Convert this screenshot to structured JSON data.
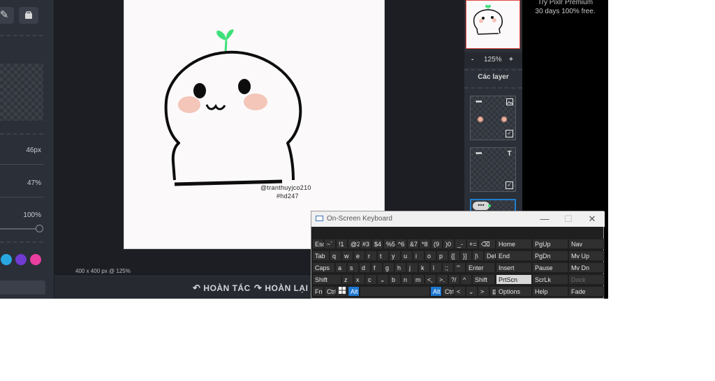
{
  "left_panel": {
    "tool_icons": [
      "pencil-icon",
      "eraser-icon"
    ],
    "values": [
      "46px",
      "47%",
      "100%"
    ],
    "colors": [
      "#29a7e1",
      "#6f3bd1",
      "#e83fa0"
    ]
  },
  "canvas": {
    "watermark_line1": "@tranthuyjco210",
    "watermark_line2": "#hd247",
    "status": "400 x 400 px @ 125%",
    "undo_label": "HOÀN TÁC",
    "redo_label": "HOÀN LẠI"
  },
  "right_panel": {
    "zoom_minus": "-",
    "zoom_value": "125%",
    "zoom_plus": "+",
    "layers_title": "Các layer",
    "layer_dots": "•••",
    "layer_type_text": "T"
  },
  "ad": {
    "title": "Try Pixlr Premium",
    "subtitle": "30 days 100% free."
  },
  "osk": {
    "title": "On-Screen Keyboard",
    "minimize": "—",
    "maximize": "☐",
    "close": "✕",
    "rows": [
      [
        [
          "Esc",
          17
        ],
        [
          "~`",
          17
        ],
        [
          "!1",
          17
        ],
        [
          "@2",
          17
        ],
        [
          "#3",
          17
        ],
        [
          "$4",
          17
        ],
        [
          "%5",
          17
        ],
        [
          "^6",
          17
        ],
        [
          "&7",
          17
        ],
        [
          "*8",
          17
        ],
        [
          "(9",
          17
        ],
        [
          ")0",
          17
        ],
        [
          "_-",
          17
        ],
        [
          "+=",
          17
        ],
        [
          "⌫",
          25
        ]
      ],
      [
        [
          "Tab",
          25
        ],
        [
          "q",
          17
        ],
        [
          "w",
          17
        ],
        [
          "e",
          17
        ],
        [
          "r",
          17
        ],
        [
          "t",
          17
        ],
        [
          "y",
          17
        ],
        [
          "u",
          17
        ],
        [
          "i",
          17
        ],
        [
          "o",
          17
        ],
        [
          "p",
          17
        ],
        [
          "{[",
          17
        ],
        [
          "}]",
          17
        ],
        [
          "|\\",
          17
        ],
        [
          "Del",
          17
        ]
      ],
      [
        [
          "Caps",
          33
        ],
        [
          "a",
          17
        ],
        [
          "s",
          17
        ],
        [
          "d",
          17
        ],
        [
          "f",
          17
        ],
        [
          "g",
          17
        ],
        [
          "h",
          17
        ],
        [
          "j",
          17
        ],
        [
          "k",
          17
        ],
        [
          "l",
          17
        ],
        [
          ":;",
          17
        ],
        [
          "\"'",
          17
        ],
        [
          "Enter",
          42
        ]
      ],
      [
        [
          "Shift",
          42
        ],
        [
          "z",
          17
        ],
        [
          "x",
          17
        ],
        [
          "c",
          17
        ],
        [
          "v",
          17
        ],
        [
          "b",
          17
        ],
        [
          "n",
          17
        ],
        [
          "m",
          17
        ],
        [
          "<,",
          17
        ],
        [
          ">.",
          17
        ],
        [
          "?/",
          17
        ],
        [
          "^",
          17
        ],
        [
          "Shift",
          33
        ]
      ],
      [
        [
          "Fn",
          17
        ],
        [
          "Ctrl",
          17
        ],
        [
          "win",
          17
        ],
        [
          "Alt",
          17
        ],
        [
          "",
          101
        ],
        [
          "Alt",
          17
        ],
        [
          "Ctrl",
          17
        ],
        [
          "<",
          17
        ],
        [
          "v",
          17
        ],
        [
          ">",
          17
        ],
        [
          "menu",
          17
        ]
      ]
    ],
    "nav_keys": [
      [
        "Home",
        "PgUp",
        "Nav"
      ],
      [
        "End",
        "PgDn",
        "Mv Up"
      ],
      [
        "Insert",
        "Pause",
        "Mv Dn"
      ],
      [
        "PrtScn",
        "ScrLk",
        "Dock"
      ],
      [
        "Options",
        "Help",
        "Fade"
      ]
    ]
  }
}
